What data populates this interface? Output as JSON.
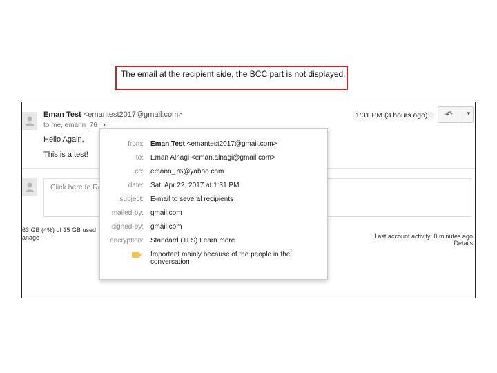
{
  "caption": "The email at the recipient side, the BCC part is not displayed.",
  "message": {
    "sender_name": "Eman Test",
    "sender_email": "<emantest2017@gmail.com>",
    "to_line": "to me, emann_76",
    "time": "1:31 PM (3 hours ago)",
    "body": [
      "Hello Again,",
      "This is a test!"
    ]
  },
  "reply_hint": "Click here to Rep",
  "storage": {
    "usage": "63 GB (4%) of 15 GB used",
    "manage": "anage"
  },
  "activity": {
    "last_activity": "Last account activity: 0 minutes ago",
    "details": "Details"
  },
  "details": {
    "from": {
      "label": "from:",
      "name": "Eman Test",
      "email": "<emantest2017@gmail.com>"
    },
    "to": {
      "label": "to:",
      "value": "Eman Alnagi <eman.alnagi@gmail.com>"
    },
    "cc": {
      "label": "cc:",
      "value": "emann_76@yahoo.com"
    },
    "date": {
      "label": "date:",
      "value": "Sat, Apr 22, 2017 at 1:31 PM"
    },
    "subject": {
      "label": "subject:",
      "value": "E-mail to several recipients"
    },
    "mailed_by": {
      "label": "mailed-by:",
      "value": "gmail.com"
    },
    "signed_by": {
      "label": "signed-by:",
      "value": "gmail.com"
    },
    "encryption": {
      "label": "encryption:",
      "value": "Standard (TLS)",
      "link": "Learn more"
    },
    "importance": {
      "icon": "importance-tag-icon",
      "line1": "Important mainly because of the people in the",
      "line2": "conversation"
    }
  },
  "colors": {
    "caption_border": "#d0232a",
    "importance_tag": "#f4c542"
  }
}
